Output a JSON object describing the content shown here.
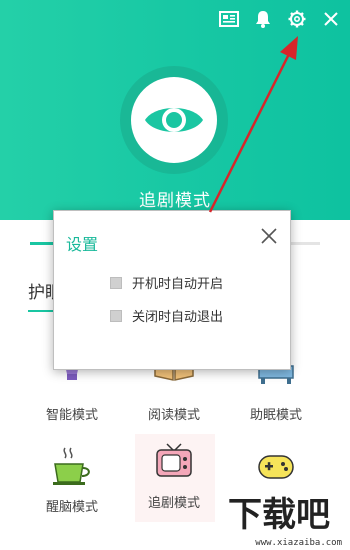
{
  "app": {
    "current_mode": "追剧模式"
  },
  "toolbar": {
    "icons": [
      "news-icon",
      "bell-icon",
      "gear-icon",
      "close-icon"
    ]
  },
  "tabs": {
    "first_tab_label": "护眼"
  },
  "modes": [
    {
      "name": "智能模式",
      "icon": "bulb-icon"
    },
    {
      "name": "阅读模式",
      "icon": "book-icon"
    },
    {
      "name": "助眠模式",
      "icon": "bed-icon"
    },
    {
      "name": "醒脑模式",
      "icon": "tea-cup-icon"
    },
    {
      "name": "追剧模式",
      "icon": "tv-icon",
      "active": true
    },
    {
      "name": "",
      "icon": "gamepad-icon"
    }
  ],
  "settings_dialog": {
    "title": "设置",
    "options": [
      {
        "label": "开机时自动开启",
        "checked": false
      },
      {
        "label": "关闭时自动退出",
        "checked": false
      }
    ]
  },
  "watermark": {
    "brand": "下载吧",
    "url": "www.xiazaiba.com"
  },
  "colors": {
    "accent": "#19c6a2",
    "arrow": "#d7262a"
  }
}
